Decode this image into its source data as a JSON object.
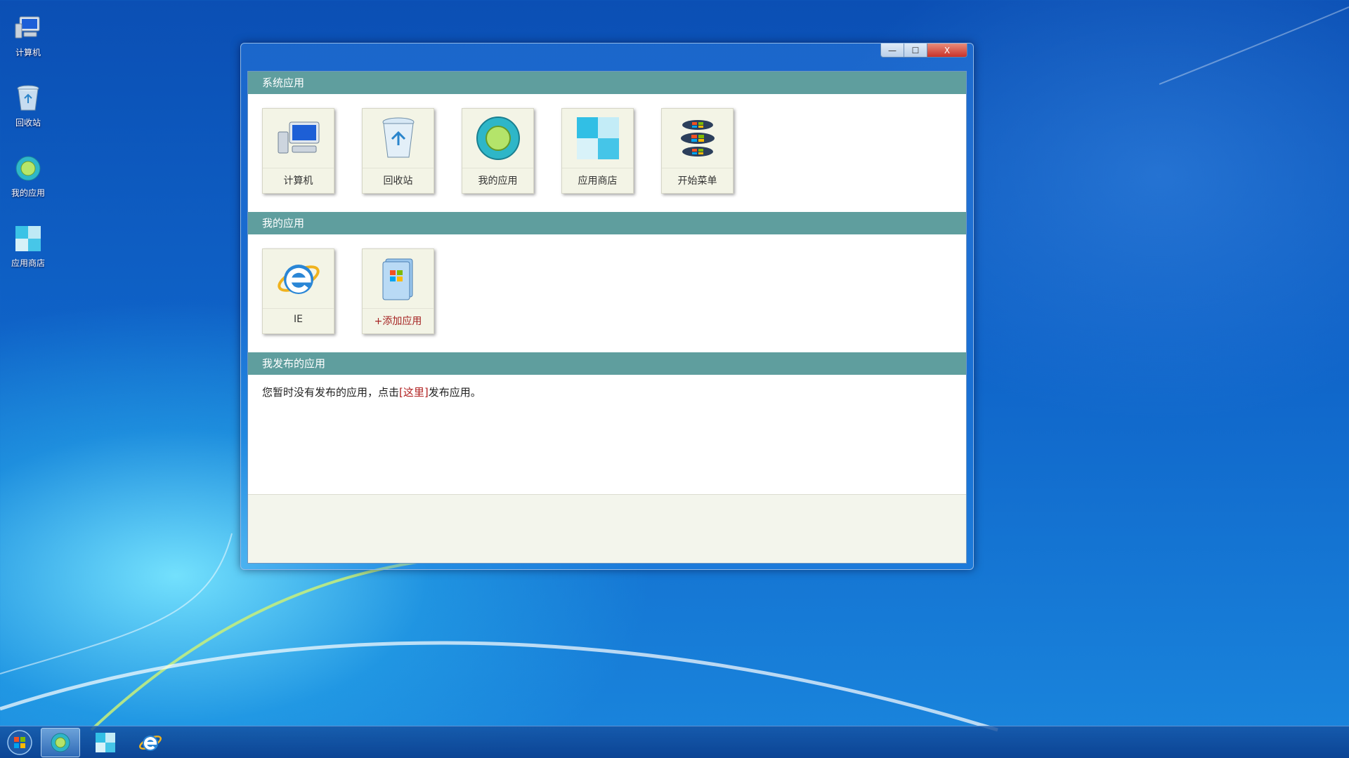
{
  "desktop": {
    "icons": [
      {
        "label": "计算机",
        "icon": "computer-icon"
      },
      {
        "label": "回收站",
        "icon": "recycle-bin-icon"
      },
      {
        "label": "我的应用",
        "icon": "my-apps-icon"
      },
      {
        "label": "应用商店",
        "icon": "app-store-icon"
      }
    ]
  },
  "window": {
    "controls": {
      "minimize": "—",
      "maximize": "☐",
      "close": "X"
    },
    "sections": {
      "system_apps": {
        "title": "系统应用",
        "items": [
          {
            "label": "计算机",
            "icon": "computer-icon"
          },
          {
            "label": "回收站",
            "icon": "recycle-bin-icon"
          },
          {
            "label": "我的应用",
            "icon": "my-apps-icon"
          },
          {
            "label": "应用商店",
            "icon": "app-store-icon"
          },
          {
            "label": "开始菜单",
            "icon": "start-menu-icon"
          }
        ]
      },
      "my_apps": {
        "title": "我的应用",
        "items": [
          {
            "label": "IE",
            "icon": "ie-icon"
          },
          {
            "label": "+添加应用",
            "icon": "add-app-icon"
          }
        ]
      },
      "published_apps": {
        "title": "我发布的应用",
        "text_before": "您暂时没有发布的应用，点击",
        "link": "[这里]",
        "text_after": "发布应用。"
      }
    }
  },
  "taskbar": {
    "items": [
      {
        "icon": "start-orb-icon"
      },
      {
        "icon": "my-apps-icon",
        "active": true
      },
      {
        "icon": "app-store-icon"
      },
      {
        "icon": "ie-icon"
      }
    ]
  },
  "colors": {
    "section_header": "#5f9e9e",
    "close_button": "#c8322a",
    "link": "#b02020"
  }
}
